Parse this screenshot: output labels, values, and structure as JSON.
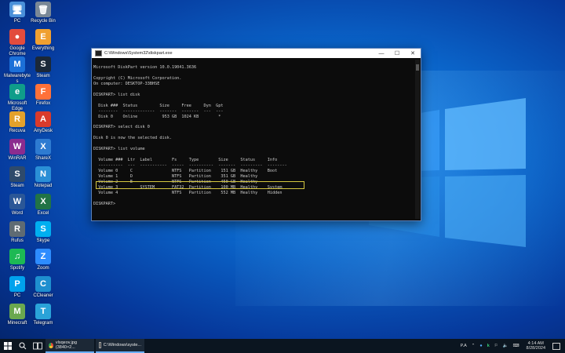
{
  "desktop": {
    "icons": [
      {
        "label": "PC",
        "glyph": "🖥",
        "color": "#4a90d9"
      },
      {
        "label": "Recycle Bin",
        "glyph": "🗑",
        "color": "#7a8896"
      },
      {
        "label": "Google Chrome",
        "glyph": "●",
        "color": "#e24c3d"
      },
      {
        "label": "Everything",
        "glyph": "E",
        "color": "#f0a030"
      },
      {
        "label": "Malwarebytes",
        "glyph": "M",
        "color": "#1c70d8"
      },
      {
        "label": "Steam",
        "glyph": "S",
        "color": "#1b2838"
      },
      {
        "label": "Microsoft Edge",
        "glyph": "e",
        "color": "#0f9d8a"
      },
      {
        "label": "Firefox",
        "glyph": "F",
        "color": "#ff7139"
      },
      {
        "label": "Recuva",
        "glyph": "R",
        "color": "#e3a12b"
      },
      {
        "label": "AnyDesk",
        "glyph": "A",
        "color": "#d93a2b"
      },
      {
        "label": "WinRAR",
        "glyph": "W",
        "color": "#8b2c8f"
      },
      {
        "label": "ShareX",
        "glyph": "X",
        "color": "#2e7bd1"
      },
      {
        "label": "Steam",
        "glyph": "S",
        "color": "#2e4a6b"
      },
      {
        "label": "Notepad",
        "glyph": "N",
        "color": "#2a8fd6"
      },
      {
        "label": "Word",
        "glyph": "W",
        "color": "#2b5797"
      },
      {
        "label": "Excel",
        "glyph": "X",
        "color": "#217346"
      },
      {
        "label": "Rufus",
        "glyph": "R",
        "color": "#5f6b73"
      },
      {
        "label": "Skype",
        "glyph": "S",
        "color": "#00aff0"
      },
      {
        "label": "Spotify",
        "glyph": "♫",
        "color": "#1db954"
      },
      {
        "label": "Zoom",
        "glyph": "Z",
        "color": "#2d8cff"
      },
      {
        "label": "PC",
        "glyph": "P",
        "color": "#00a2ed"
      },
      {
        "label": "CCleaner",
        "glyph": "C",
        "color": "#1e8fcf"
      },
      {
        "label": "Minecraft",
        "glyph": "M",
        "color": "#6aa84f"
      },
      {
        "label": "Telegram",
        "glyph": "T",
        "color": "#2aa3d8"
      }
    ]
  },
  "window": {
    "title": "C:\\Windows\\System32\\diskpart.exe",
    "minimize": "—",
    "maximize": "☐",
    "close": "✕",
    "console_lines": [
      "",
      "Microsoft DiskPart version 10.0.19041.3636",
      "",
      "Copyright (C) Microsoft Corporation.",
      "On computer: DESKTOP-33BHSE",
      "",
      "DISKPART> list disk",
      "",
      "  Disk ###  Status         Size     Free     Dyn  Gpt",
      "  --------  -------------  -------  -------  ---  ---",
      "  Disk 0    Online          953 GB  1024 KB        *",
      "",
      "DISKPART> select disk 0",
      "",
      "Disk 0 is now the selected disk.",
      "",
      "DISKPART> list volume",
      "",
      "  Volume ###  Ltr  Label        Fs     Type        Size     Status     Info",
      "  ----------  ---  -----------  -----  ----------  -------  ---------  --------",
      "  Volume 0     C                NTFS   Partition    151 GB  Healthy    Boot",
      "  Volume 1     D                NTFS   Partition    351 GB  Healthy",
      "  Volume 2     E                NTFS   Partition    450 GB  Healthy",
      "  Volume 3         SYSTEM       FAT32  Partition    100 MB  Healthy    System",
      "  Volume 4                      NTFS   Partition    552 MB  Healthy    Hidden",
      "",
      "DISKPART> "
    ]
  },
  "taskbar": {
    "start_icon": "windows-logo",
    "search_icon": "search",
    "taskview_icon": "task-view",
    "apps": [
      {
        "label": "vlsqeov.jpg (3840×2..."
      },
      {
        "label": "C:\\Windows\\syste..."
      }
    ],
    "tray": {
      "lang": "P.A",
      "up_arrow": "⌃",
      "tray_icons": [
        "●",
        "k",
        "⚐",
        "🔈",
        "⌨"
      ],
      "time": "4:14 AM",
      "date": "8/28/2024"
    }
  }
}
